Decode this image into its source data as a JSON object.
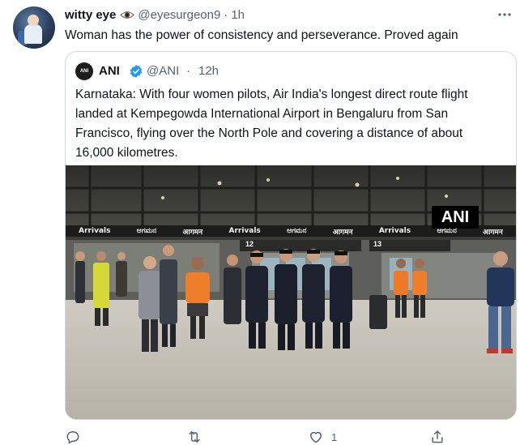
{
  "tweet": {
    "display_name": "witty eye",
    "handle": "@eyesurgeon9",
    "separator": "·",
    "time": "1h",
    "text": "Woman has the power of consistency and perseverance. Proved again",
    "more_icon": "more-icon"
  },
  "quoted": {
    "avatar_text": "ANI",
    "display_name": "ANI",
    "handle": "@ANI",
    "separator": "·",
    "time": "12h",
    "text_lines": [
      "Karnataka: With four women pilots, Air India's longest direct route flight",
      "landed at Kempegowda International Airport in Bengaluru from San",
      "Francisco, flying over the North Pole and covering a distance of about",
      "16,000 kilometres."
    ],
    "photo": {
      "watermark": "ANI",
      "signs": [
        "Arrivals",
        "ಆಗಮನ",
        "आगमन",
        "Arrivals",
        "ಆಗಮನ",
        "आगमन",
        "Arrivals",
        "ಆಗಮನ",
        "आगमन"
      ],
      "gate_left": "12",
      "gate_right": "13"
    }
  },
  "actions": {
    "reply_count": "",
    "retweet_count": "",
    "like_count": "1",
    "share_count": ""
  },
  "colors": {
    "text": "#0f1419",
    "secondary": "#536471",
    "border": "#cfd9de",
    "verified": "#1d9bf0"
  }
}
